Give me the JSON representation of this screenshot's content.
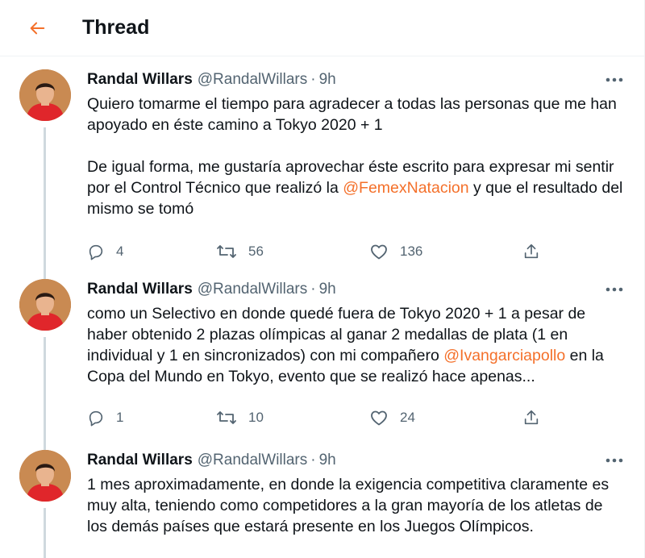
{
  "header": {
    "title": "Thread",
    "accent": "#f4702a"
  },
  "tweets": [
    {
      "name": "Randal Willars",
      "handle": "@RandalWillars",
      "time": "9h",
      "text_a": "Quiero tomarme el tiempo para agradecer a todas las personas que me han apoyado en éste camino a Tokyo 2020 + 1\n\nDe igual forma, me gustaría aprovechar éste escrito para expresar mi sentir por el Control Técnico que realizó la ",
      "mention": "@FemexNatacion",
      "text_b": " y que el resultado del mismo se tomó",
      "replies": "4",
      "retweets": "56",
      "likes": "136"
    },
    {
      "name": "Randal Willars",
      "handle": "@RandalWillars",
      "time": "9h",
      "text_a": "como un Selectivo en donde quedé fuera de Tokyo 2020 + 1 a pesar de haber obtenido 2 plazas olímpicas al ganar 2 medallas de plata (1 en individual y 1 en sincronizados) con mi compañero ",
      "mention": "@Ivangarciapollo",
      "text_b": " en la Copa del Mundo en Tokyo, evento que se realizó hace apenas...",
      "replies": "1",
      "retweets": "10",
      "likes": "24"
    },
    {
      "name": "Randal Willars",
      "handle": "@RandalWillars",
      "time": "9h",
      "text_a": "1 mes aproximadamente, en donde la exigencia competitiva claramente es muy alta, teniendo como competidores a la gran mayoría de los atletas de los demás países que estará presente en los Juegos Olímpicos."
    }
  ],
  "icons": {
    "back": "back-arrow-icon",
    "more": "more-dots-icon",
    "reply": "reply-bubble-icon",
    "retweet": "retweet-icon",
    "like": "heart-icon",
    "share": "share-icon"
  }
}
